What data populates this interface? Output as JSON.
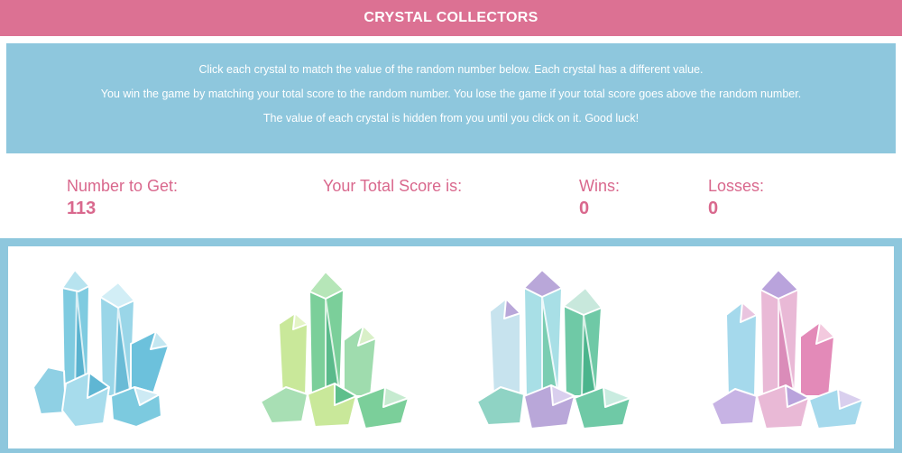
{
  "header": {
    "title": "CRYSTAL COLLECTORS"
  },
  "instructions": {
    "lines": [
      "Click each crystal to match the value of the random number below. Each crystal has a different value.",
      "You win the game by matching your total score to the random number. You lose the game if your total score goes above the random number.",
      "The value of each crystal is hidden from you until you click on it. Good luck!"
    ]
  },
  "stats": {
    "target_label": "Number to Get:",
    "target_value": "113",
    "score_label": "Your Total Score is:",
    "score_value": "",
    "wins_label": "Wins:",
    "wins_value": "0",
    "losses_label": "Losses:",
    "losses_value": "0"
  },
  "crystals": [
    {
      "icon": "blue-crystal-cluster-icon",
      "colors": [
        "#7fcbe0",
        "#b7e3ef",
        "#4aa8c8"
      ]
    },
    {
      "icon": "green-crystal-cluster-icon",
      "colors": [
        "#7bcf9a",
        "#c9e89a",
        "#4fb487"
      ]
    },
    {
      "icon": "teal-purple-crystal-cluster-icon",
      "colors": [
        "#6fc9a6",
        "#b9a7d9",
        "#a8dfe6"
      ]
    },
    {
      "icon": "pink-purple-crystal-cluster-icon",
      "colors": [
        "#e38ab8",
        "#b9a3dc",
        "#a5d9ec"
      ]
    }
  ],
  "theme": {
    "header_bg": "#dc7193",
    "accent": "#d9688d",
    "panel_bg": "#8ec7dd"
  }
}
